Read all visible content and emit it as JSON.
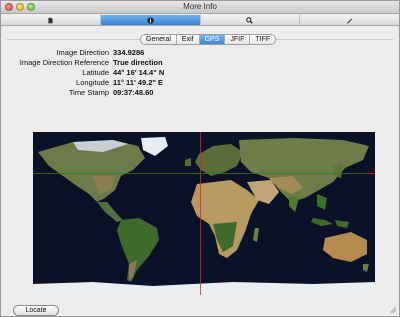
{
  "window": {
    "title": "More Info"
  },
  "toolbar": {
    "buttons": [
      {
        "icon": "document-icon",
        "active": false
      },
      {
        "icon": "info-icon",
        "active": true
      },
      {
        "icon": "search-icon",
        "active": false
      },
      {
        "icon": "pencil-icon",
        "active": false
      }
    ]
  },
  "tabs": [
    {
      "label": "General",
      "selected": false
    },
    {
      "label": "Exif",
      "selected": false
    },
    {
      "label": "GPS",
      "selected": true
    },
    {
      "label": "JFIF",
      "selected": false
    },
    {
      "label": "TIFF",
      "selected": false
    }
  ],
  "properties": [
    {
      "key": "Image Direction",
      "value": "334.9286"
    },
    {
      "key": "Image Direction Reference",
      "value": "True direction"
    },
    {
      "key": "Latitude",
      "value": "44° 16' 14.4\" N"
    },
    {
      "key": "Longitude",
      "value": "11° 11' 49.2\" E"
    },
    {
      "key": "Time Stamp",
      "value": "09:37:48.60"
    }
  ],
  "map": {
    "latitude": 44.2707,
    "longitude": 11.197
  },
  "actions": {
    "locate_label": "Locate"
  },
  "colors": {
    "accent": "#3d86d6",
    "crosshair": "#e0202a",
    "ocean": "#0b1127"
  }
}
